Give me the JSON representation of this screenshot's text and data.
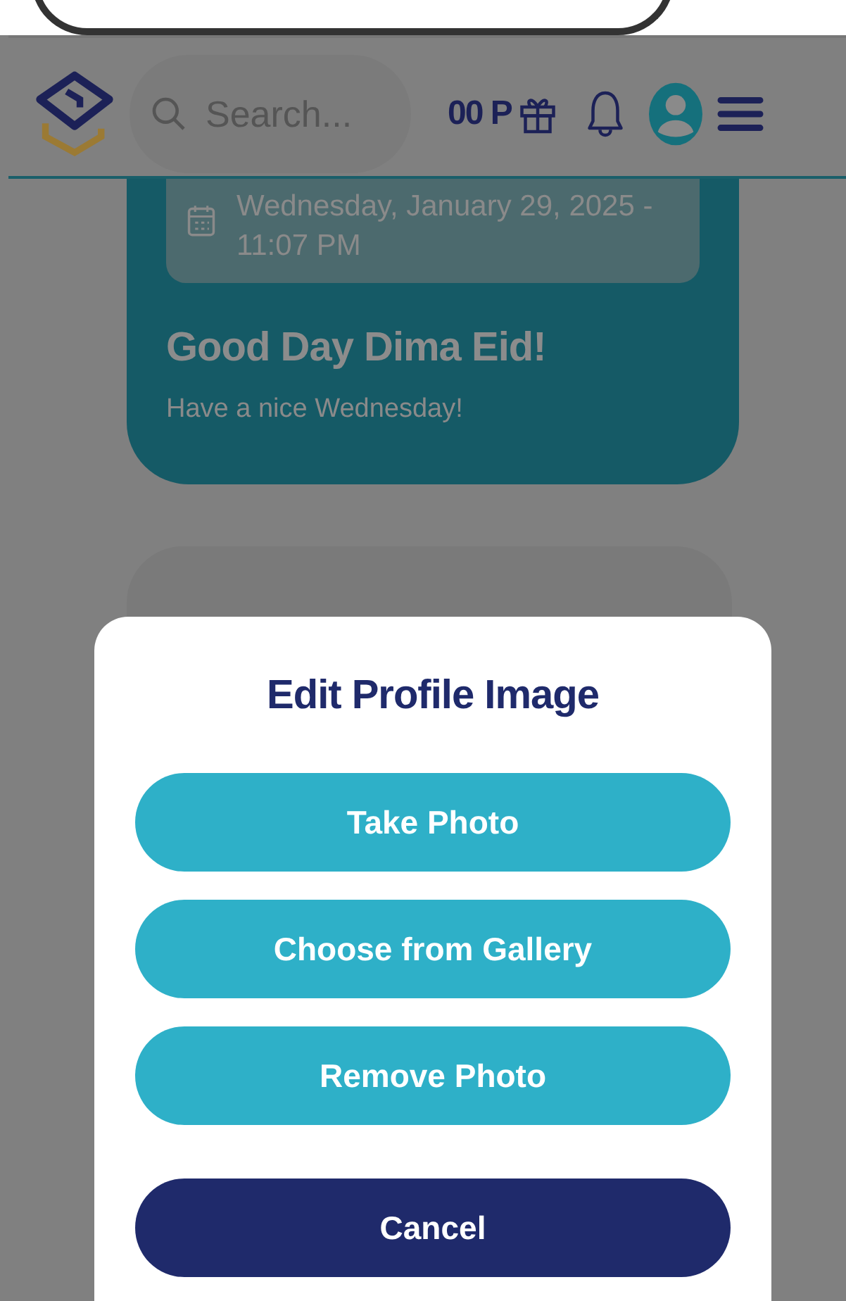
{
  "header": {
    "search": {
      "placeholder": "Search..."
    },
    "points": "00 P"
  },
  "greeting_card": {
    "date": "Wednesday, January 29, 2025 - 11:07 PM",
    "title": "Good Day Dima Eid!",
    "subtitle": "Have a nice Wednesday!"
  },
  "dialog": {
    "title": "Edit Profile Image",
    "buttons": [
      {
        "label": "Take Photo",
        "kind": "option"
      },
      {
        "label": "Choose from Gallery",
        "kind": "option"
      },
      {
        "label": "Remove Photo",
        "kind": "option"
      },
      {
        "label": "Cancel",
        "kind": "cancel"
      }
    ]
  }
}
